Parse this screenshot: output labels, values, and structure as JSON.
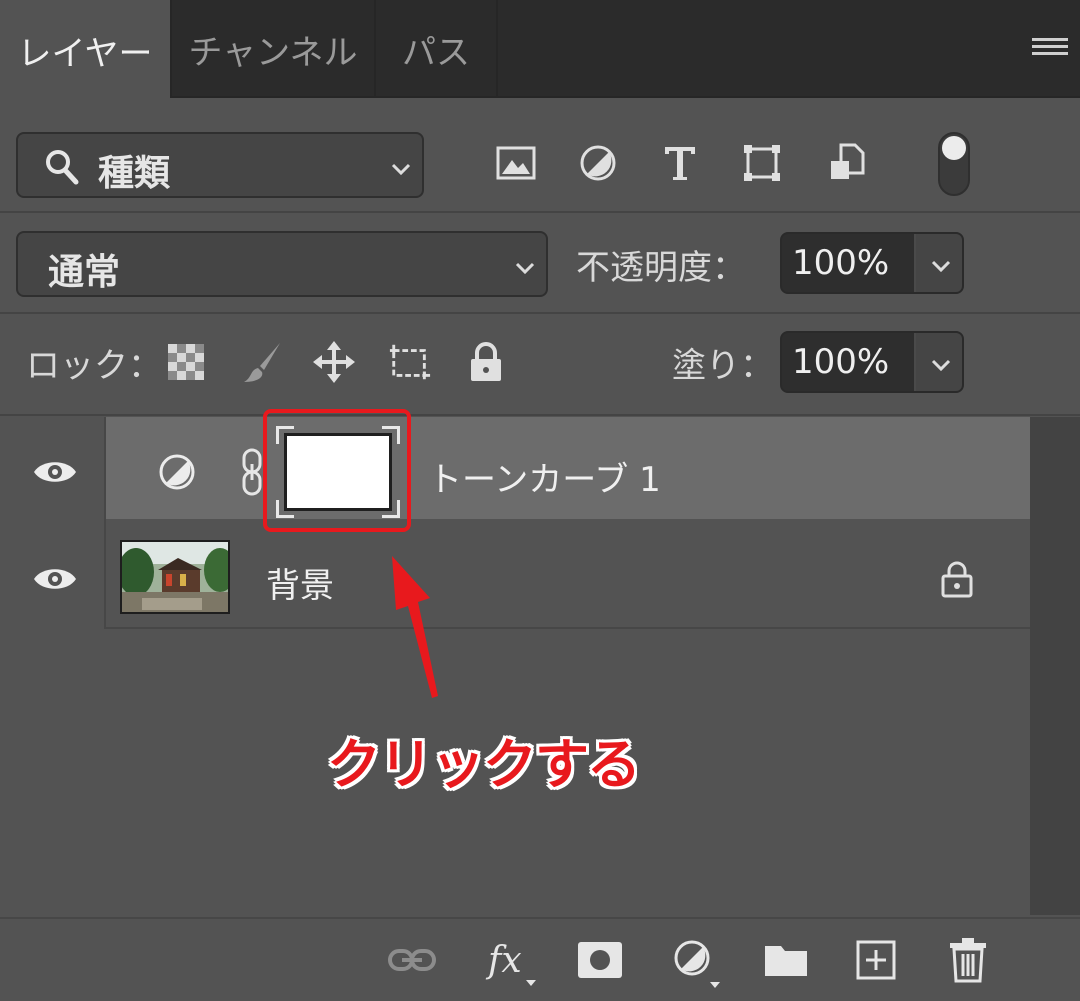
{
  "tabs": [
    {
      "label": "レイヤー",
      "active": true
    },
    {
      "label": "チャンネル",
      "active": false
    },
    {
      "label": "パス",
      "active": false
    }
  ],
  "filter": {
    "kind_label": "種類"
  },
  "blend": {
    "mode": "通常",
    "opacity_label": "不透明度：",
    "opacity_value": "100%"
  },
  "lock": {
    "label": "ロック：",
    "fill_label": "塗り：",
    "fill_value": "100%"
  },
  "layers": [
    {
      "name": "トーンカーブ 1",
      "visible": true,
      "selected": true,
      "type": "adjustment"
    },
    {
      "name": "背景",
      "visible": true,
      "selected": false,
      "locked": true
    }
  ],
  "annotation": {
    "text": "クリックする",
    "color": "#e8191d"
  },
  "colors": {
    "panel": "#535353",
    "selected_row": "#6c6c6c",
    "highlight": "#e8191d"
  }
}
